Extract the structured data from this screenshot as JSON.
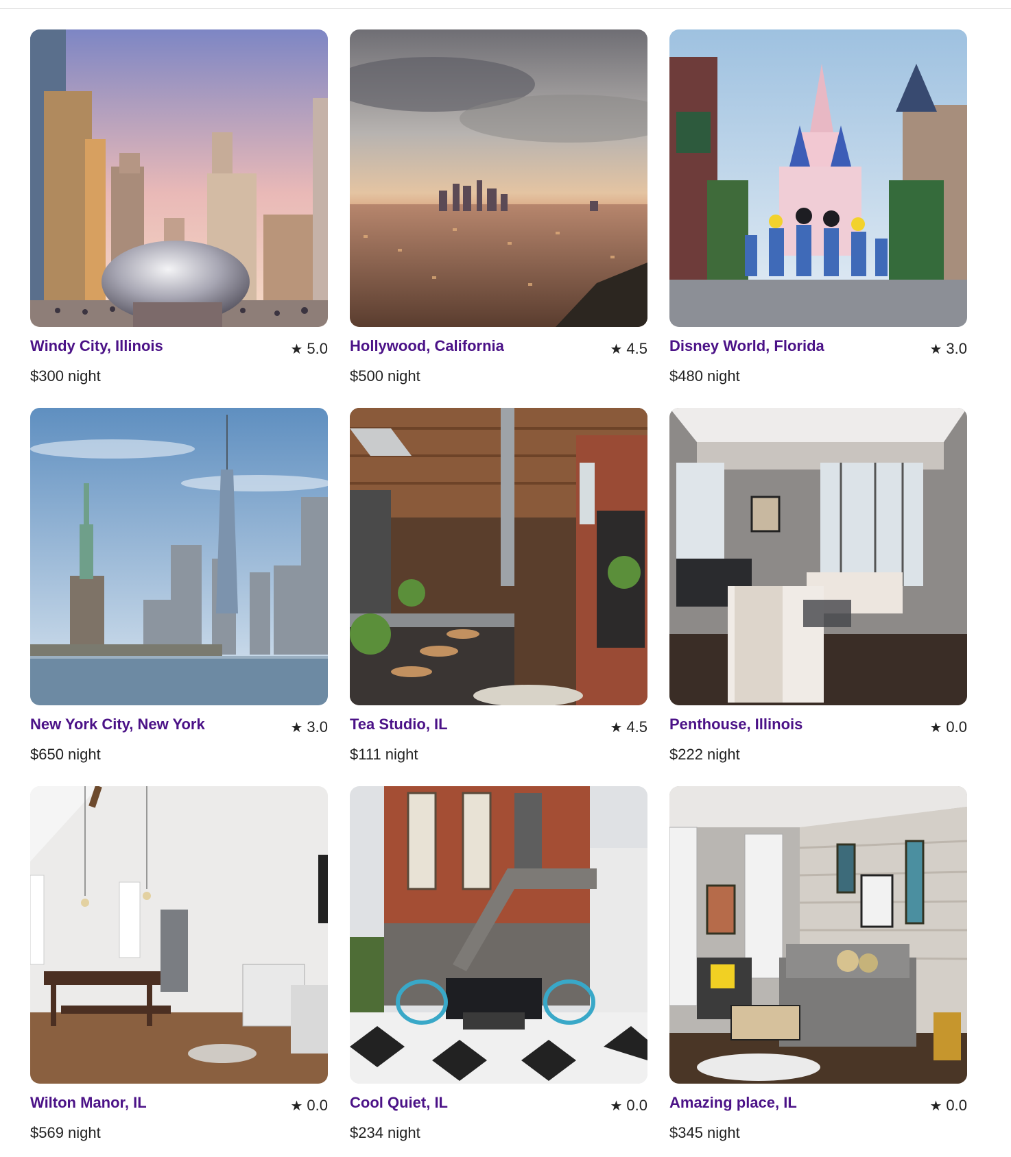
{
  "listings": [
    {
      "title": "Windy City, Illinois",
      "rating": "5.0",
      "price": "$300 night",
      "image": "chicago-bean-skyline"
    },
    {
      "title": "Hollywood, California",
      "rating": "4.5",
      "price": "$500 night",
      "image": "los-angeles-sunset-skyline"
    },
    {
      "title": "Disney World, Florida",
      "rating": "3.0",
      "price": "$480 night",
      "image": "castle-characters-main-street"
    },
    {
      "title": "New York City, New York",
      "rating": "3.0",
      "price": "$650 night",
      "image": "statue-of-liberty-skyline"
    },
    {
      "title": "Tea Studio, IL",
      "rating": "4.5",
      "price": "$111 night",
      "image": "industrial-loft-kitchen"
    },
    {
      "title": "Penthouse, Illinois",
      "rating": "0.0",
      "price": "$222 night",
      "image": "penthouse-living-room"
    },
    {
      "title": "Wilton Manor, IL",
      "rating": "0.0",
      "price": "$569 night",
      "image": "bright-dining-kitchen"
    },
    {
      "title": "Cool Quiet, IL",
      "rating": "0.0",
      "price": "$234 night",
      "image": "brick-house-patio"
    },
    {
      "title": "Amazing place, IL",
      "rating": "0.0",
      "price": "$345 night",
      "image": "living-room-wood-wall"
    }
  ],
  "icons": {
    "rating": "star-icon"
  },
  "colors": {
    "title": "#4b1287",
    "text": "#222222"
  }
}
